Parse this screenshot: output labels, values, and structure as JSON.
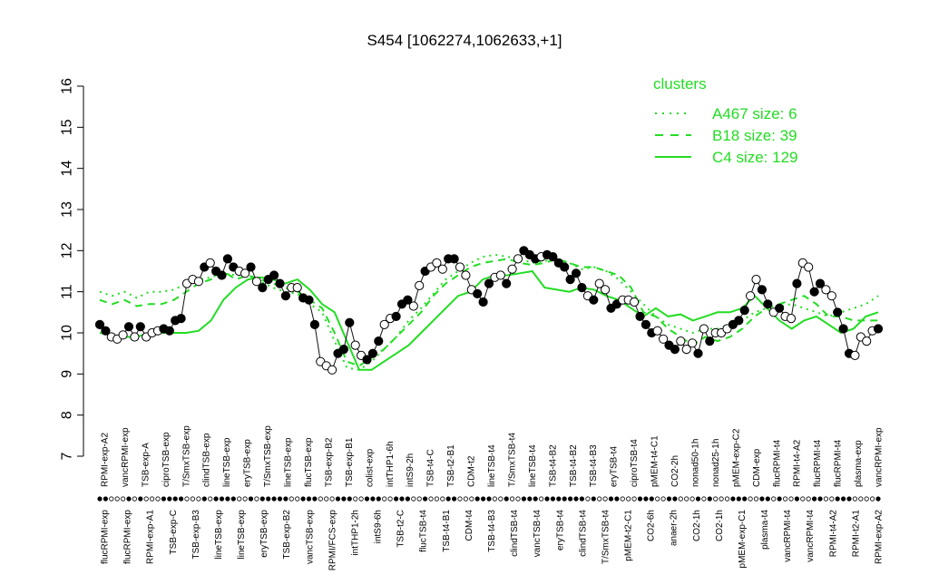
{
  "chart_data": {
    "type": "line",
    "title": "S454 [1062274,1062633,+1]",
    "ylim": [
      7,
      16
    ],
    "yticks": [
      7,
      8,
      9,
      10,
      11,
      12,
      13,
      14,
      15,
      16
    ],
    "legend": {
      "title": "clusters",
      "placement": "top-right",
      "entries": [
        {
          "label": "A467 size: 6",
          "style": "dotted"
        },
        {
          "label": "B18 size: 39",
          "style": "dashed"
        },
        {
          "label": "C4 size: 129",
          "style": "solid"
        }
      ]
    },
    "colors": {
      "line": "#22dd22",
      "axis": "#000000",
      "point_open": "#ffffff",
      "point_filled": "#000000"
    },
    "x_labels_top": [
      "RPMI-exp-A2",
      "vancRPMI-exp",
      "TSB-exp-A",
      "ciproTSB-exp",
      "T/SmxTSB-exp",
      "clindTSB-exp",
      "lineTSB-exp",
      "eryTSB-exp",
      "T/SmxTSB-exp",
      "lineTSB-exp",
      "flucTSB-exp",
      "TSB-exp-B2",
      "TSB-exp-B1",
      "colist-exp",
      "intTHP1-6h",
      "intS9-2h",
      "TSB-t4-C",
      "TSB-t2-B1",
      "CDM-t2",
      "lineTSB-t4",
      "T/SmxTSB-t4",
      "lineTSB-t4",
      "TSB-t4-B2",
      "TSB-t4-B2",
      "TSB-t4-B3",
      "eryTSB-t4",
      "ciproTSB-t4",
      "pMEM-t4-C1",
      "CO2-2h",
      "nonad50-1h",
      "nonad25-1h",
      "pMEM-exp-C2",
      "CDM-exp",
      "flucRPMI-t4",
      "RPMI-t4-A2",
      "flucRPMI-t4",
      "flucRPMI-t4",
      "plasma-exp",
      "vancRPMI-exp"
    ],
    "x_labels_bottom": [
      "flucRPMI-exp",
      "flucRPMI-exp",
      "RPMI-exp-A1",
      "TSB-exp-C",
      "TSB-exp-B3",
      "lineTSB-exp",
      "lineTSB-exp",
      "eryTSB-exp",
      "TSB-exp-B2",
      "vancTSB-exp",
      "RPMI/FCS-exp",
      "intTHP1-2h",
      "intS9-6h",
      "TSB-t2-C",
      "flucTSB-t4",
      "TSB-t4-B1",
      "CDM-t4",
      "TSB-t4-B3",
      "clindTSB-t4",
      "vancTSB-t4",
      "eryTSB-t4",
      "clindTSB-t4",
      "T/SmxTSB-t4",
      "pMEM-t2-C1",
      "CO2-6h",
      "anaer-2h",
      "CO2-1h",
      "CO2-1h",
      "pMEM-exp-C1",
      "plasma-t4",
      "vancRPMI-t4",
      "vancRPMI-t4",
      "RPMI-t4-A2",
      "RPMI-t2-A1",
      "RPMI-exp-A2"
    ],
    "points": [
      10.2,
      10.05,
      9.9,
      9.85,
      9.95,
      10.15,
      9.9,
      10.15,
      9.9,
      10.0,
      10.05,
      10.1,
      10.05,
      10.3,
      10.35,
      11.2,
      11.3,
      11.25,
      11.6,
      11.7,
      11.5,
      11.4,
      11.8,
      11.6,
      11.5,
      11.45,
      11.6,
      11.25,
      11.1,
      11.3,
      11.4,
      11.2,
      10.9,
      11.1,
      11.1,
      10.85,
      10.8,
      10.2,
      9.3,
      9.2,
      9.1,
      9.5,
      9.6,
      10.25,
      9.7,
      9.45,
      9.35,
      9.5,
      9.8,
      10.2,
      10.35,
      10.4,
      10.7,
      10.8,
      10.65,
      11.15,
      11.5,
      11.6,
      11.7,
      11.55,
      11.8,
      11.8,
      11.6,
      11.4,
      11.05,
      10.95,
      10.75,
      11.2,
      11.35,
      11.4,
      11.2,
      11.55,
      11.8,
      12.0,
      11.9,
      11.8,
      11.85,
      11.9,
      11.85,
      11.7,
      11.6,
      11.3,
      11.45,
      11.1,
      10.9,
      10.8,
      11.2,
      11.05,
      10.6,
      10.7,
      10.8,
      10.8,
      10.75,
      10.4,
      10.2,
      10.0,
      10.05,
      9.85,
      9.7,
      9.6,
      9.8,
      9.6,
      9.75,
      9.5,
      10.1,
      9.8,
      10.0,
      10.0,
      10.1,
      10.2,
      10.3,
      10.55,
      10.9,
      11.3,
      11.05,
      10.7,
      10.5,
      10.6,
      10.4,
      10.35,
      11.2,
      11.7,
      11.6,
      11.0,
      11.2,
      11.05,
      10.9,
      10.5,
      10.1,
      9.5,
      9.45,
      9.9,
      9.8,
      10.05,
      10.1
    ],
    "filled": [
      1,
      1,
      0,
      0,
      0,
      1,
      0,
      1,
      0,
      0,
      0,
      1,
      1,
      1,
      1,
      0,
      0,
      0,
      1,
      0,
      1,
      1,
      1,
      1,
      0,
      0,
      1,
      0,
      1,
      1,
      1,
      1,
      1,
      0,
      0,
      1,
      1,
      1,
      0,
      0,
      0,
      1,
      1,
      1,
      0,
      0,
      1,
      1,
      1,
      0,
      0,
      1,
      1,
      1,
      0,
      0,
      1,
      0,
      0,
      0,
      1,
      1,
      0,
      0,
      0,
      1,
      1,
      1,
      0,
      0,
      1,
      0,
      0,
      1,
      1,
      1,
      0,
      1,
      1,
      1,
      1,
      1,
      1,
      1,
      0,
      1,
      0,
      0,
      1,
      1,
      0,
      0,
      0,
      1,
      1,
      1,
      0,
      0,
      1,
      1,
      0,
      0,
      0,
      1,
      0,
      1,
      0,
      0,
      0,
      1,
      1,
      1,
      0,
      0,
      1,
      1,
      0,
      1,
      0,
      0,
      1,
      0,
      0,
      1,
      1,
      0,
      0,
      1,
      1,
      1,
      0,
      0,
      0,
      0
    ],
    "cluster_C4": [
      10.0,
      9.95,
      9.9,
      9.9,
      10.0,
      10.0,
      10.0,
      10.0,
      10.05,
      10.3,
      10.8,
      11.1,
      11.3,
      11.35,
      11.3,
      11.2,
      11.3,
      11.05,
      10.7,
      10.5,
      9.8,
      9.1,
      9.1,
      9.3,
      9.5,
      9.7,
      10.0,
      10.3,
      10.6,
      10.9,
      11.0,
      11.3,
      11.4,
      11.4,
      11.45,
      11.5,
      11.1,
      11.05,
      11.0,
      11.1,
      11.05,
      10.9,
      10.8,
      10.6,
      10.4,
      10.6,
      10.4,
      10.45,
      10.3,
      10.4,
      10.5,
      10.5,
      10.6,
      10.9,
      10.6,
      10.3,
      10.1,
      10.3,
      10.4,
      10.2,
      10.0,
      10.1,
      10.4,
      10.5
    ],
    "cluster_B18": [
      10.8,
      10.7,
      10.8,
      10.65,
      10.7,
      10.7,
      10.8,
      11.0,
      11.2,
      11.3,
      11.5,
      11.3,
      11.4,
      11.3,
      11.2,
      11.1,
      11.0,
      10.8,
      10.6,
      10.0,
      9.3,
      9.2,
      9.4,
      9.6,
      9.9,
      10.2,
      10.5,
      10.9,
      11.2,
      11.4,
      11.6,
      11.7,
      11.75,
      11.8,
      11.7,
      11.65,
      11.7,
      11.8,
      11.7,
      11.6,
      11.6,
      11.5,
      11.4,
      11.1,
      10.5,
      10.4,
      10.1,
      9.9,
      9.7,
      9.9,
      9.8,
      9.9,
      10.1,
      10.4,
      10.6,
      10.7,
      10.8,
      10.9,
      10.7,
      10.4,
      10.4,
      10.3,
      10.3,
      10.3
    ],
    "cluster_A467": [
      11.0,
      10.9,
      11.0,
      10.85,
      11.0,
      11.0,
      11.05,
      11.2,
      11.3,
      11.35,
      11.45,
      11.4,
      11.4,
      11.25,
      11.1,
      11.0,
      10.95,
      10.7,
      10.5,
      9.8,
      9.15,
      9.1,
      9.3,
      9.6,
      9.9,
      10.3,
      10.6,
      10.95,
      11.3,
      11.5,
      11.7,
      11.85,
      11.9,
      11.85,
      11.8,
      11.7,
      11.75,
      11.8,
      11.7,
      11.55,
      11.6,
      11.5,
      11.3,
      11.0,
      10.7,
      10.4,
      10.2,
      10.1,
      10.0,
      10.1,
      10.1,
      10.2,
      10.3,
      10.5,
      10.6,
      10.65,
      10.7,
      10.6,
      10.5,
      10.4,
      10.5,
      10.6,
      10.7,
      10.9
    ]
  }
}
